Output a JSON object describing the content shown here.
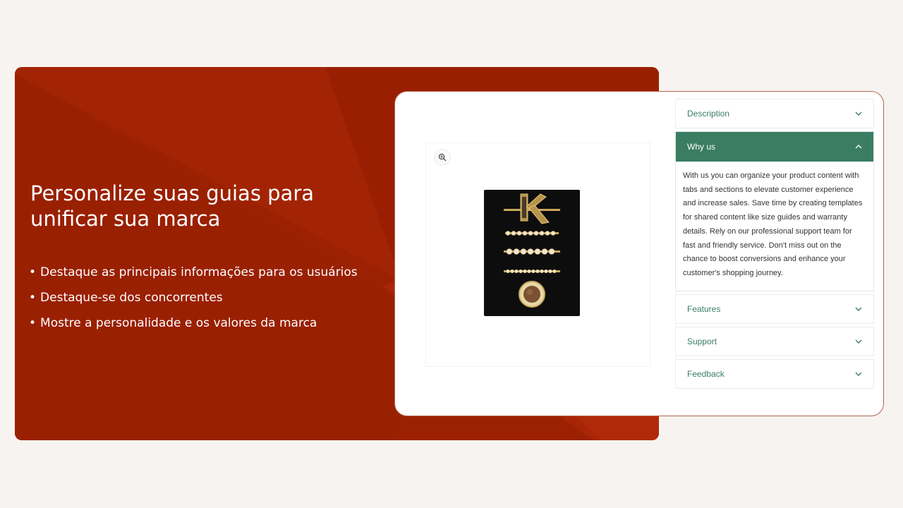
{
  "promo": {
    "headline": "Personalize suas guias para unificar sua marca",
    "bullets": [
      "Destaque as principais informações para os usuários",
      "Destaque-se dos concorrentes",
      "Mostre a personalidade e os valores da marca"
    ]
  },
  "product": {
    "zoom_icon": "zoom-in-icon",
    "image": "hair-clip-set"
  },
  "tabs": [
    {
      "label": "Description",
      "open": false
    },
    {
      "label": "Why us",
      "open": true,
      "content": "With us you can organize your product content with tabs and sections to elevate customer experience and increase sales. Save time by creating templates for shared content like size guides and warranty details. Rely on our professional support team for fast and friendly service. Don't miss out on the chance to boost conversions and enhance your customer's shopping journey."
    },
    {
      "label": "Features",
      "open": false
    },
    {
      "label": "Support",
      "open": false
    },
    {
      "label": "Feedback",
      "open": false
    }
  ],
  "colors": {
    "page_bg": "#f7f3f0",
    "promo_bg": "#9c2102",
    "accent_green": "#3a7d63",
    "card_border": "#b5654f"
  }
}
